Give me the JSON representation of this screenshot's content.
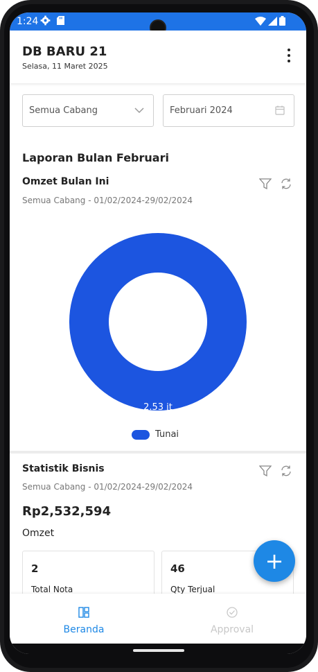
{
  "status_bar": {
    "time": "1:24"
  },
  "header": {
    "title": "DB BARU 21",
    "date": "Selasa, 11 Maret 2025"
  },
  "filters": {
    "branch_value": "Semua Cabang",
    "month_value": "Februari 2024"
  },
  "report": {
    "section_title": "Laporan Bulan Februari"
  },
  "omzet_card": {
    "title": "Omzet Bulan Ini",
    "subtitle": "Semua Cabang - 01/02/2024-29/02/2024"
  },
  "chart_data": {
    "type": "pie",
    "donut": true,
    "categories": [
      "Tunai"
    ],
    "values": [
      2.53
    ],
    "data_labels": [
      "2.53 jt"
    ],
    "legend": [
      "Tunai"
    ],
    "legend_position": "bottom",
    "colors": [
      "#1c55e0"
    ]
  },
  "stats_card": {
    "title": "Statistik Bisnis",
    "subtitle": "Semua Cabang - 01/02/2024-29/02/2024",
    "amount": "Rp2,532,594",
    "amount_label": "Omzet",
    "boxes": [
      {
        "value": "2",
        "label": "Total Nota"
      },
      {
        "value": "46",
        "label": "Qty Terjual"
      }
    ]
  },
  "fab": {
    "symbol": "+"
  },
  "bottom_nav": {
    "items": [
      {
        "label": "Beranda",
        "active": true,
        "icon": "dashboard-icon"
      },
      {
        "label": "Approval",
        "active": false,
        "icon": "check-circle-icon"
      }
    ]
  },
  "colors": {
    "accent": "#1e73e6",
    "chart": "#1c55e0",
    "fab": "#1e88e5"
  }
}
